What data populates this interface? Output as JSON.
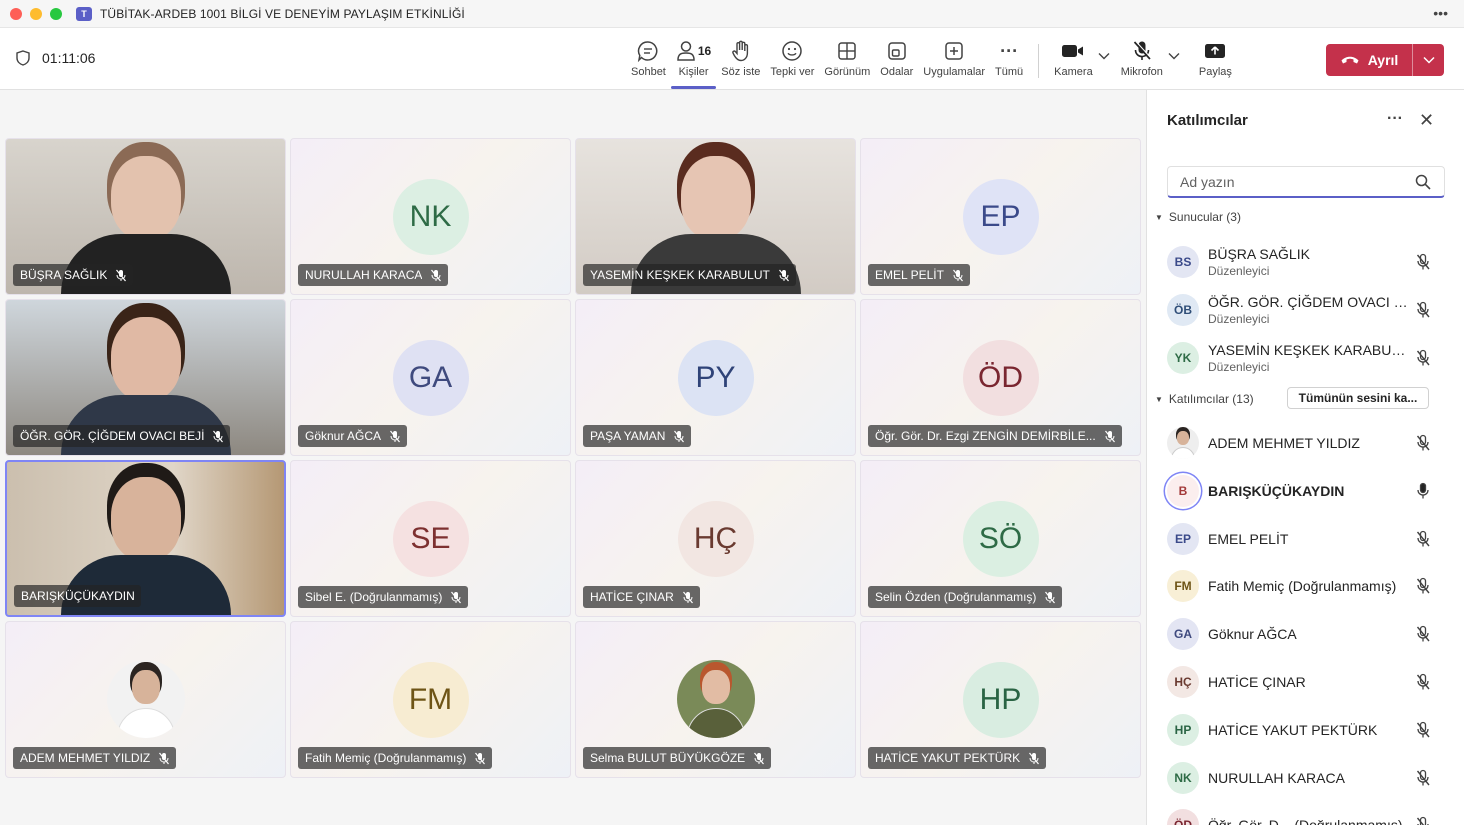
{
  "window": {
    "title": "TÜBİTAK-ARDEB 1001 BİLGİ VE DENEYİM PAYLAŞIM ETKİNLİĞİ",
    "more": "•••"
  },
  "toolbar": {
    "timer": "01:11:06",
    "chat": "Sohbet",
    "people": "Kişiler",
    "people_count": "16",
    "raise": "Söz iste",
    "react": "Tepki ver",
    "view": "Görünüm",
    "rooms": "Odalar",
    "apps": "Uygulamalar",
    "more": "Tümü",
    "more_glyph": "···",
    "camera": "Kamera",
    "mic": "Mikrofon",
    "share": "Paylaş",
    "leave": "Ayrıl"
  },
  "tiles": [
    {
      "name": "BÜŞRA SAĞLIK",
      "kind": "video"
    },
    {
      "name": "NURULLAH KARACA",
      "initials": "NK",
      "bg": "#dcefe3",
      "fg": "#2e6b46"
    },
    {
      "name": "YASEMİN KEŞKEK KARABULUT",
      "kind": "video"
    },
    {
      "name": "EMEL PELİT",
      "initials": "EP",
      "bg": "#dfe3f6",
      "fg": "#3b4a8a"
    },
    {
      "name": "ÖĞR. GÖR. ÇİĞDEM OVACI BEJİ",
      "kind": "video"
    },
    {
      "name": "Göknur AĞCA",
      "initials": "GA",
      "bg": "#dfe1f3",
      "fg": "#3f4a7e"
    },
    {
      "name": "PAŞA YAMAN",
      "initials": "PY",
      "bg": "#dce3f4",
      "fg": "#2f4378"
    },
    {
      "name": "Öğr. Gör. Dr. Ezgi ZENGİN DEMİRBİLE...",
      "initials": "ÖD",
      "bg": "#f2dfe0",
      "fg": "#7a2630"
    },
    {
      "name": "BARIŞKÜÇÜKAYDIN",
      "kind": "video"
    },
    {
      "name": "Sibel E. (Doğrulanmamış)",
      "initials": "SE",
      "bg": "#f5e1e1",
      "fg": "#7d3030"
    },
    {
      "name": "HATİCE ÇINAR",
      "initials": "HÇ",
      "bg": "#f2e6e2",
      "fg": "#6a3a30"
    },
    {
      "name": "Selin Özden (Doğrulanmamış)",
      "initials": "SÖ",
      "bg": "#dbefe2",
      "fg": "#2e6b46"
    },
    {
      "name": "ADEM MEHMET YILDIZ",
      "kind": "photo"
    },
    {
      "name": "Fatih Memiç (Doğrulanmamış)",
      "initials": "FM",
      "bg": "#f7ecd2",
      "fg": "#6e5416"
    },
    {
      "name": "Selma BULUT BÜYÜKGÖZE",
      "kind": "photo2"
    },
    {
      "name": "HATİCE YAKUT PEKTÜRK",
      "initials": "HP",
      "bg": "#d9ede1",
      "fg": "#2a6444"
    }
  ],
  "panel": {
    "title": "Katılımcılar",
    "more": "···",
    "close": "✕",
    "search_placeholder": "Ad yazın",
    "presenters_label": "Sunucular (3)",
    "attendees_label": "Katılımcılar (13)",
    "mute_all": "Tümünün sesini ka...",
    "presenters": [
      {
        "initials": "BS",
        "name": "BÜŞRA SAĞLIK",
        "role": "Düzenleyici",
        "bg": "#e3e6f3",
        "fg": "#3b4a8a"
      },
      {
        "initials": "ÖB",
        "name": "ÖĞR. GÖR. ÇİĞDEM OVACI B...",
        "role": "Düzenleyici",
        "bg": "#e0e9f4",
        "fg": "#2f4e78"
      },
      {
        "initials": "YK",
        "name": "YASEMİN KEŞKEK KARABUL...",
        "role": "Düzenleyici",
        "bg": "#dcefe3",
        "fg": "#2e6b46"
      }
    ],
    "attendees": [
      {
        "initials": "",
        "name": "ADEM MEHMET YILDIZ",
        "photo": true
      },
      {
        "initials": "B",
        "name": "BARIŞKÜÇÜKAYDIN",
        "bg": "#fbeeee",
        "fg": "#a33a3a",
        "bold": true,
        "unmuted": true
      },
      {
        "initials": "EP",
        "name": "EMEL PELİT",
        "bg": "#e3e6f3",
        "fg": "#3b4a8a"
      },
      {
        "initials": "FM",
        "name": "Fatih Memiç (Doğrulanmamış)",
        "bg": "#f8efd6",
        "fg": "#6e5416"
      },
      {
        "initials": "GA",
        "name": "Göknur AĞCA",
        "bg": "#e3e5f3",
        "fg": "#3f4a7e"
      },
      {
        "initials": "HÇ",
        "name": "HATİCE ÇINAR",
        "bg": "#f3e8e4",
        "fg": "#6a3a30"
      },
      {
        "initials": "HP",
        "name": "HATİCE YAKUT PEKTÜRK",
        "bg": "#dcefe3",
        "fg": "#2a6444"
      },
      {
        "initials": "NK",
        "name": "NURULLAH KARACA",
        "bg": "#dcefe3",
        "fg": "#2e6b46"
      },
      {
        "initials": "ÖD",
        "name": "Öğr. Gör. D... (Doğrulanmamış)",
        "bg": "#f2dfe0",
        "fg": "#7a2630"
      }
    ]
  }
}
